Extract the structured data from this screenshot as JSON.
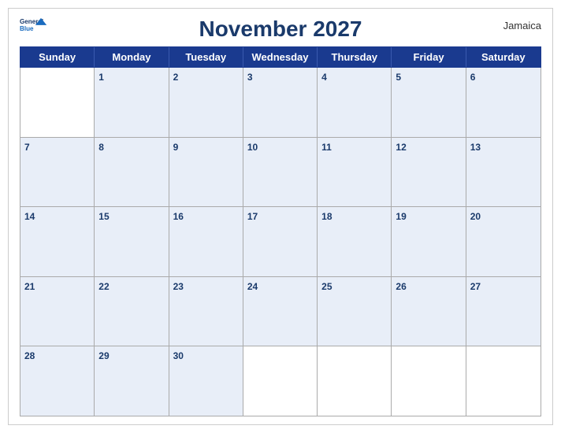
{
  "calendar": {
    "title": "November 2027",
    "country": "Jamaica",
    "logo": {
      "line1": "General",
      "line2": "Blue"
    },
    "days": [
      "Sunday",
      "Monday",
      "Tuesday",
      "Wednesday",
      "Thursday",
      "Friday",
      "Saturday"
    ],
    "weeks": [
      [
        {
          "date": "",
          "empty": true
        },
        {
          "date": "1"
        },
        {
          "date": "2"
        },
        {
          "date": "3"
        },
        {
          "date": "4"
        },
        {
          "date": "5"
        },
        {
          "date": "6"
        }
      ],
      [
        {
          "date": "7"
        },
        {
          "date": "8"
        },
        {
          "date": "9"
        },
        {
          "date": "10"
        },
        {
          "date": "11"
        },
        {
          "date": "12"
        },
        {
          "date": "13"
        }
      ],
      [
        {
          "date": "14"
        },
        {
          "date": "15"
        },
        {
          "date": "16"
        },
        {
          "date": "17"
        },
        {
          "date": "18"
        },
        {
          "date": "19"
        },
        {
          "date": "20"
        }
      ],
      [
        {
          "date": "21"
        },
        {
          "date": "22"
        },
        {
          "date": "23"
        },
        {
          "date": "24"
        },
        {
          "date": "25"
        },
        {
          "date": "26"
        },
        {
          "date": "27"
        }
      ],
      [
        {
          "date": "28"
        },
        {
          "date": "29"
        },
        {
          "date": "30"
        },
        {
          "date": "",
          "empty": true
        },
        {
          "date": "",
          "empty": true
        },
        {
          "date": "",
          "empty": true
        },
        {
          "date": "",
          "empty": true
        }
      ]
    ]
  }
}
